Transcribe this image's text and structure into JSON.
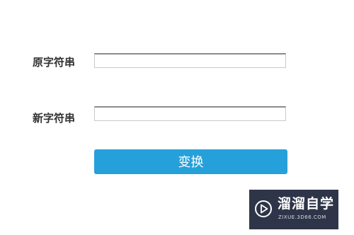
{
  "form": {
    "original_label": "原字符串",
    "original_value": "",
    "new_label": "新字符串",
    "new_value": "",
    "convert_button": "变换"
  },
  "watermark": {
    "title": "溜溜自学",
    "url": "ZIXUE.3D66.COM",
    "icon": "play-icon"
  },
  "colors": {
    "button": "#26a0da",
    "watermark_bg": "#2e3548"
  }
}
